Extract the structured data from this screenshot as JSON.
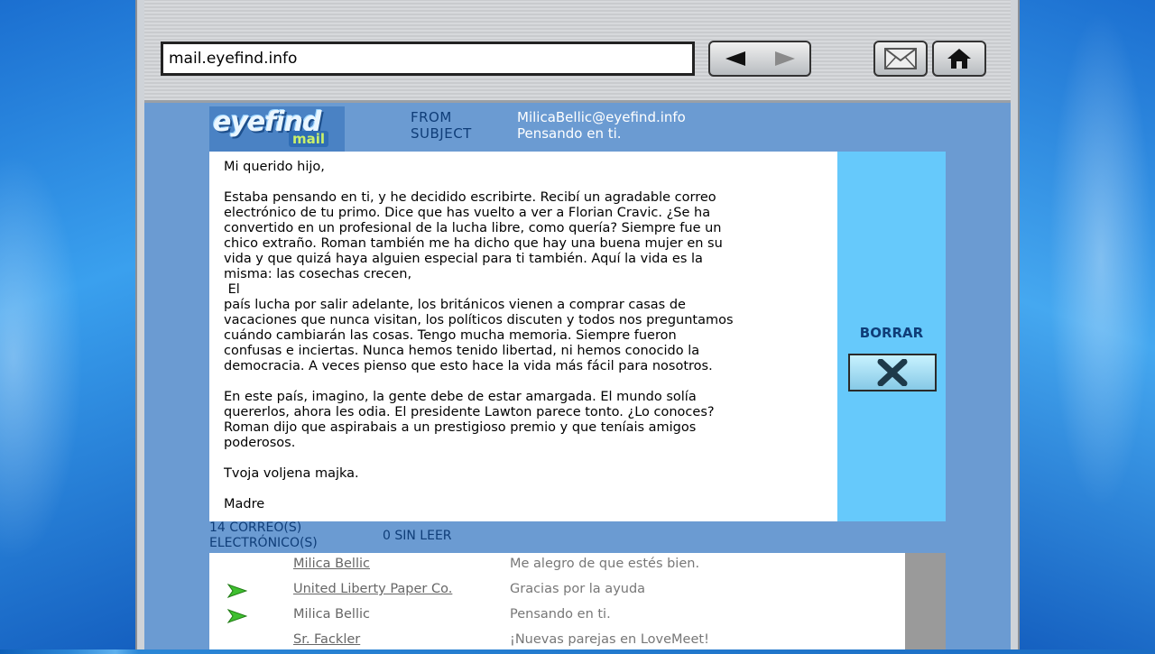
{
  "browser": {
    "url": "mail.eyefind.info"
  },
  "logo": {
    "line1": "eyefind",
    "line2": "mail"
  },
  "header": {
    "from_label": "FROM",
    "from_value": "MilicaBellic@eyefind.info",
    "subject_label": "SUBJECT",
    "subject_value": "Pensando en ti."
  },
  "message": {
    "body": "Mi querido hijo,\n\nEstaba pensando en ti, y he decidido escribirte. Recibí un agradable correo\nelectrónico de tu primo. Dice que has vuelto a ver a Florian Cravic. ¿Se ha\nconvertido en un profesional de la lucha libre, como quería? Siempre fue un\nchico extraño. Roman también me ha dicho que hay una buena mujer en su\nvida y que quizá haya alguien especial para ti también. Aquí la vida es la\nmisma: las cosechas crecen,\n El\npaís lucha por salir adelante, los británicos vienen a comprar casas de\nvacaciones que nunca visitan, los políticos discuten y todos nos preguntamos\ncuándo cambiarán las cosas. Tengo mucha memoria. Siempre fueron\nconfusas e inciertas. Nunca hemos tenido libertad, ni hemos conocido la\ndemocracia. A veces pienso que esto hace la vida más fácil para nosotros.\n\nEn este país, imagino, la gente debe de estar amargada. El mundo solía\nquererlos, ahora les odia. El presidente Lawton parece tonto. ¿Lo conoces?\nRoman dijo que aspirabais a un prestigioso premio y que teníais amigos\npoderosos.\n\nTvoja voljena majka.\n\nMadre"
  },
  "actions": {
    "delete_label": "BORRAR",
    "delete_icon": "x-icon"
  },
  "mailbox": {
    "count_label": "14 CORREO(S) ELECTRÓNICO(S)",
    "unread_label": "0 SIN LEER",
    "items": [
      {
        "sender": "Milica Bellic",
        "subject": "Me alegro de que estés bien.",
        "replied": false,
        "link": true
      },
      {
        "sender": "United Liberty Paper Co.",
        "subject": "Gracias por la ayuda",
        "replied": true,
        "link": true
      },
      {
        "sender": "Milica Bellic",
        "subject": "Pensando en ti.",
        "replied": true,
        "link": false
      },
      {
        "sender": "Sr. Fackler",
        "subject": "¡Nuevas parejas en LoveMeet!",
        "replied": false,
        "link": true
      }
    ]
  },
  "colors": {
    "content_bg": "#6b9bd2",
    "side_panel": "#66c9fb",
    "label_text": "#0f3d78",
    "reply_arrow": "#3fbf2f"
  }
}
